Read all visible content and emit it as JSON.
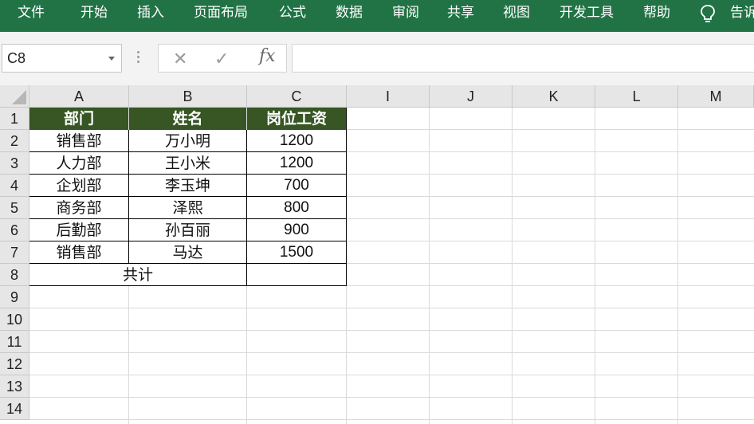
{
  "ribbon": {
    "menu": [
      "文件",
      "开始",
      "插入",
      "页面布局",
      "公式",
      "数据",
      "审阅",
      "共享",
      "视图",
      "开发工具",
      "帮助"
    ],
    "tell_me": "告诉"
  },
  "formula_bar": {
    "name_box": "C8",
    "fx_label": "fx",
    "formula": ""
  },
  "columns": [
    "A",
    "B",
    "C",
    "I",
    "J",
    "K",
    "L",
    "M"
  ],
  "rows": [
    "1",
    "2",
    "3",
    "4",
    "5",
    "6",
    "7",
    "8",
    "9",
    "10",
    "11",
    "12",
    "13",
    "14"
  ],
  "table": {
    "headers": [
      "部门",
      "姓名",
      "岗位工资"
    ],
    "rows": [
      [
        "销售部",
        "万小明",
        "1200"
      ],
      [
        "人力部",
        "王小米",
        "1200"
      ],
      [
        "企划部",
        "李玉坤",
        "700"
      ],
      [
        "商务部",
        "泽熙",
        "800"
      ],
      [
        "后勤部",
        "孙百丽",
        "900"
      ],
      [
        "销售部",
        "马达",
        "1500"
      ]
    ],
    "total_label": "共计",
    "total_value": ""
  },
  "colors": {
    "ribbon": "#217346",
    "table_header": "#375623"
  }
}
